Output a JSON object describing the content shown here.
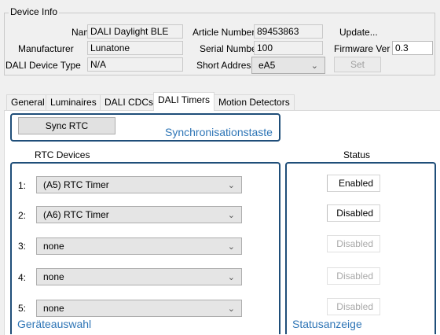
{
  "device_info": {
    "title": "Device Info",
    "name_label": "Name",
    "name_value": "DALI Daylight BLE",
    "manufacturer_label": "Manufacturer",
    "manufacturer_value": "Lunatone",
    "device_type_label": "DALI Device Type",
    "device_type_value": "N/A",
    "article_label": "Article Number",
    "article_value": "89453863",
    "serial_label": "Serial Number",
    "serial_value": "100",
    "short_address_label": "Short Address",
    "short_address_value": "eA5",
    "update_label": "Update...",
    "firmware_label": "Firmware Ver",
    "firmware_value": "0.3",
    "set_label": "Set"
  },
  "tabs": [
    {
      "label": "General"
    },
    {
      "label": "Luminaires"
    },
    {
      "label": "DALI CDCs"
    },
    {
      "label": "DALI Timers",
      "active": true
    },
    {
      "label": "Motion Detectors"
    }
  ],
  "timers": {
    "sync_button": "Sync RTC",
    "rtc_header": "RTC Devices",
    "status_header": "Status",
    "rows": [
      {
        "index": "1:",
        "device": "(A5) RTC Timer",
        "status": "Enabled",
        "active": true
      },
      {
        "index": "2:",
        "device": "(A6) RTC Timer",
        "status": "Disabled",
        "active": true
      },
      {
        "index": "3:",
        "device": "none",
        "status": "Disabled",
        "active": false
      },
      {
        "index": "4:",
        "device": "none",
        "status": "Disabled",
        "active": false
      },
      {
        "index": "5:",
        "device": "none",
        "status": "Disabled",
        "active": false
      }
    ]
  },
  "annotations": {
    "sync": "Synchronisationstaste",
    "devices": "Geräteauswahl",
    "status": "Statusanzeige"
  },
  "colors": {
    "annotation_border": "#1f4e79",
    "annotation_text": "#2e75b6"
  }
}
